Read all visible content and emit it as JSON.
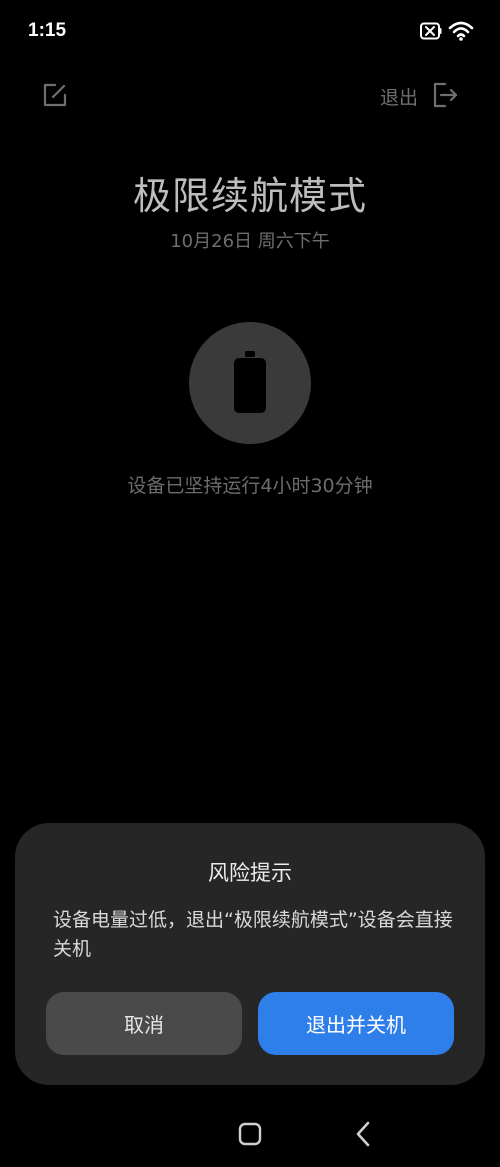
{
  "status_bar": {
    "time": "1:15"
  },
  "top_bar": {
    "exit_label": "退出"
  },
  "header": {
    "title": "极限续航模式",
    "date": "10月26日 周六下午"
  },
  "battery_status": {
    "runtime_text": "设备已坚持运行4小时30分钟"
  },
  "dialog": {
    "title": "风险提示",
    "message": "设备电量过低，退出“极限续航模式”设备会直接关机",
    "cancel_label": "取消",
    "confirm_label": "退出并关机"
  },
  "colors": {
    "background": "#000000",
    "dialog_background": "#262626",
    "confirm_button": "#2f7fea",
    "cancel_button": "#4a4a4a",
    "battery_circle": "#3a3a3a"
  },
  "icons": {
    "edit": "edit-icon",
    "exit": "exit-icon",
    "battery": "battery-icon",
    "wifi": "wifi-icon",
    "home": "home-icon",
    "back": "back-icon"
  }
}
